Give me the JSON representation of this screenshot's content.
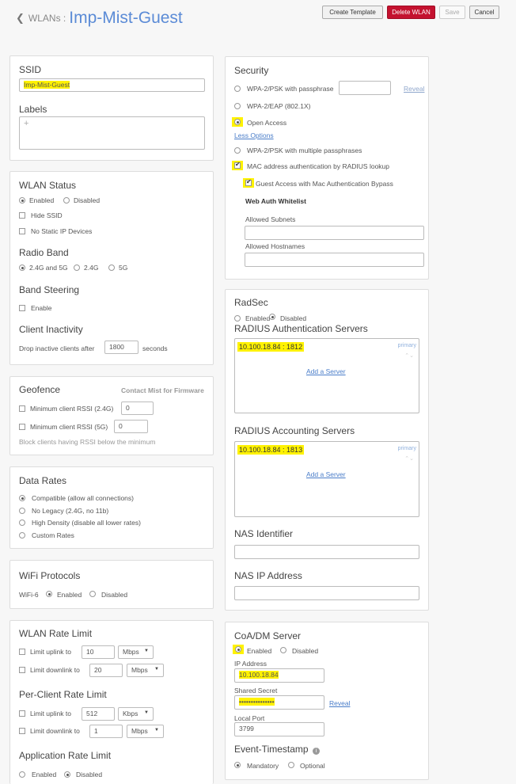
{
  "header": {
    "breadcrumb": "WLANs :",
    "title": "Imp-Mist-Guest",
    "buttons": {
      "create_template": "Create Template",
      "delete_wlan": "Delete WLAN",
      "save": "Save",
      "cancel": "Cancel"
    }
  },
  "ssid": {
    "label": "SSID",
    "value": "Imp-Mist-Guest",
    "labels_heading": "Labels",
    "add_symbol": "+"
  },
  "wlan_status": {
    "heading": "WLAN Status",
    "enabled": "Enabled",
    "disabled": "Disabled",
    "hide_ssid": "Hide SSID",
    "no_static_ip": "No Static IP Devices",
    "radio_band_heading": "Radio Band",
    "band_both": "2.4G and 5G",
    "band_24": "2.4G",
    "band_5": "5G",
    "band_steering_heading": "Band Steering",
    "band_steering_enable": "Enable",
    "client_inactivity_heading": "Client Inactivity",
    "drop_label": "Drop inactive clients after",
    "drop_value": "1800",
    "drop_unit": "seconds"
  },
  "geofence": {
    "heading": "Geofence",
    "contact": "Contact Mist for Firmware",
    "min_rssi_24": "Minimum client RSSI (2.4G)",
    "min_rssi_24_value": "0",
    "min_rssi_5": "Minimum client RSSI (5G)",
    "min_rssi_5_value": "0",
    "note": "Block clients having RSSI below the minimum"
  },
  "data_rates": {
    "heading": "Data Rates",
    "options": [
      "Compatible (allow all connections)",
      "No Legacy (2.4G, no 11b)",
      "High Density (disable all lower rates)",
      "Custom Rates"
    ]
  },
  "wifi_protocols": {
    "heading": "WiFi Protocols",
    "wifi6": "WiFi-6",
    "enabled": "Enabled",
    "disabled": "Disabled"
  },
  "rate_limit": {
    "heading": "WLAN Rate Limit",
    "uplink": "Limit uplink to",
    "uplink_value": "10",
    "uplink_unit": "Mbps",
    "downlink": "Limit downlink to",
    "downlink_value": "20",
    "downlink_unit": "Mbps",
    "per_client_heading": "Per-Client Rate Limit",
    "pc_uplink_value": "512",
    "pc_uplink_unit": "Kbps",
    "pc_downlink_value": "1",
    "pc_downlink_unit": "Mbps",
    "app_heading": "Application Rate Limit",
    "app_enabled": "Enabled",
    "app_disabled": "Disabled"
  },
  "security": {
    "heading": "Security",
    "wpa2_psk": "WPA-2/PSK with passphrase",
    "reveal": "Reveal",
    "wpa2_eap": "WPA-2/EAP (802.1X)",
    "open_access": "Open Access",
    "less_options": "Less Options",
    "wpa2_multi": "WPA-2/PSK with multiple passphrases",
    "mac_auth": "MAC address authentication by RADIUS lookup",
    "guest_bypass": "Guest Access with Mac Authentication Bypass",
    "whitelist_heading": "Web Auth Whitelist",
    "allowed_subnets": "Allowed Subnets",
    "allowed_hostnames": "Allowed Hostnames"
  },
  "radius": {
    "radsec_heading": "RadSec",
    "enabled": "Enabled",
    "disabled": "Disabled",
    "auth_heading": "RADIUS Authentication Servers",
    "auth_server": "10.100.18.84 : 1812",
    "primary": "primary",
    "add_server": "Add a Server",
    "acct_heading": "RADIUS Accounting Servers",
    "acct_server": "10.100.18.84 : 1813",
    "nas_id_heading": "NAS Identifier",
    "nas_ip_heading": "NAS IP Address"
  },
  "coa": {
    "heading": "CoA/DM Server",
    "enabled": "Enabled",
    "disabled": "Disabled",
    "ip_label": "IP Address",
    "ip_value": "10.100.18.84",
    "secret_label": "Shared Secret",
    "secret_value": "•••••••••••••••",
    "reveal": "Reveal",
    "port_label": "Local Port",
    "port_value": "3799",
    "event_heading": "Event-Timestamp",
    "mandatory": "Mandatory",
    "optional": "Optional"
  }
}
